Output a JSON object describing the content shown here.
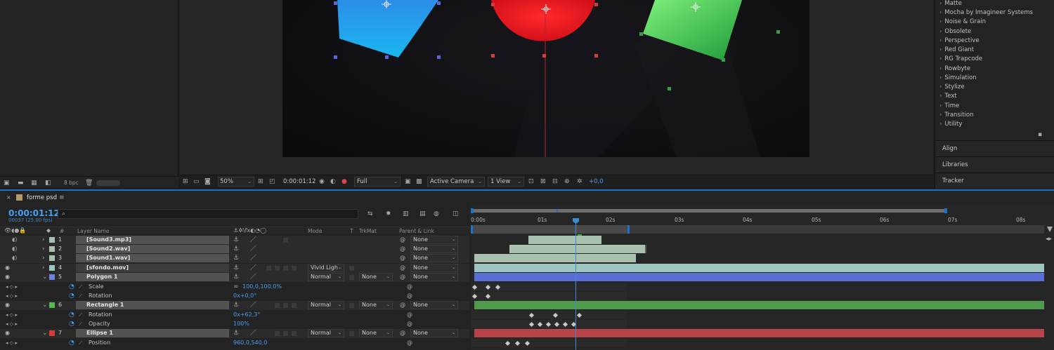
{
  "project_panel": {
    "bit_depth": "8 bpc"
  },
  "viewer": {
    "zoom": "50%",
    "timecode": "0:00:01:12",
    "resolution": "Full",
    "camera": "Active Camera",
    "views": "1 View",
    "exposure": "+0,0"
  },
  "effects_panel": {
    "items": [
      "Matte",
      "Mocha by Imagineer Systems",
      "Noise & Grain",
      "Obsolete",
      "Perspective",
      "Red Giant",
      "RG Trapcode",
      "Rowbyte",
      "Simulation",
      "Stylize",
      "Text",
      "Time",
      "Transition",
      "Utility"
    ],
    "panels": [
      "Align",
      "Libraries",
      "Tracker"
    ]
  },
  "timeline": {
    "tab_title": "forme psd",
    "current_time": "0:00:01:12",
    "frame_info": "00037 (25.00 fps)",
    "search_placeholder": "",
    "column_headers": {
      "hash": "#",
      "layer_name": "Layer Name",
      "mode": "Mode",
      "t": "T",
      "trkmat": "TrkMat",
      "parent": "Parent & Link"
    },
    "ruler_ticks": [
      "0:00s",
      "01s",
      "02s",
      "03s",
      "04s",
      "05s",
      "06s",
      "07s",
      "08s"
    ],
    "layers": [
      {
        "num": "1",
        "name": "[Sound3.mp3]",
        "parent": "None"
      },
      {
        "num": "2",
        "name": "[Sound2.wav]",
        "parent": "None"
      },
      {
        "num": "3",
        "name": "[Sound1.wav]",
        "parent": "None"
      },
      {
        "num": "4",
        "name": "[sfondo.mov]",
        "mode": "Vivid Ligh",
        "parent": "None"
      },
      {
        "num": "5",
        "name": "Polygon 1",
        "mode": "Normal",
        "trkmat": "None",
        "parent": "None"
      },
      {
        "num": "6",
        "name": "Rectangle 1",
        "mode": "Normal",
        "trkmat": "None",
        "parent": "None"
      },
      {
        "num": "7",
        "name": "Ellipse 1",
        "mode": "Normal",
        "trkmat": "None",
        "parent": "None"
      }
    ],
    "properties": {
      "scale": {
        "name": "Scale",
        "value": "100,0,100,0%"
      },
      "rotation_poly": {
        "name": "Rotation",
        "value": "0x+0,0°"
      },
      "rotation_rect": {
        "name": "Rotation",
        "value": "0x+62,3°"
      },
      "opacity": {
        "name": "Opacity",
        "value": "100%"
      },
      "position": {
        "name": "Position",
        "value": "960,0,540,0"
      }
    }
  },
  "colors": {
    "accent": "#1a72c9",
    "timecode": "#46a0f5",
    "layer_audio_bar": "#a9c2b0",
    "layer_video_bar": "#9ec6c0",
    "polygon_bar": "#5a6fd6",
    "rectangle_bar": "#4f9a4c",
    "ellipse_bar": "#b8444a",
    "polygon_swatch": "#7081e0",
    "rectangle_swatch": "#55b84f",
    "ellipse_swatch": "#d23c3c"
  }
}
